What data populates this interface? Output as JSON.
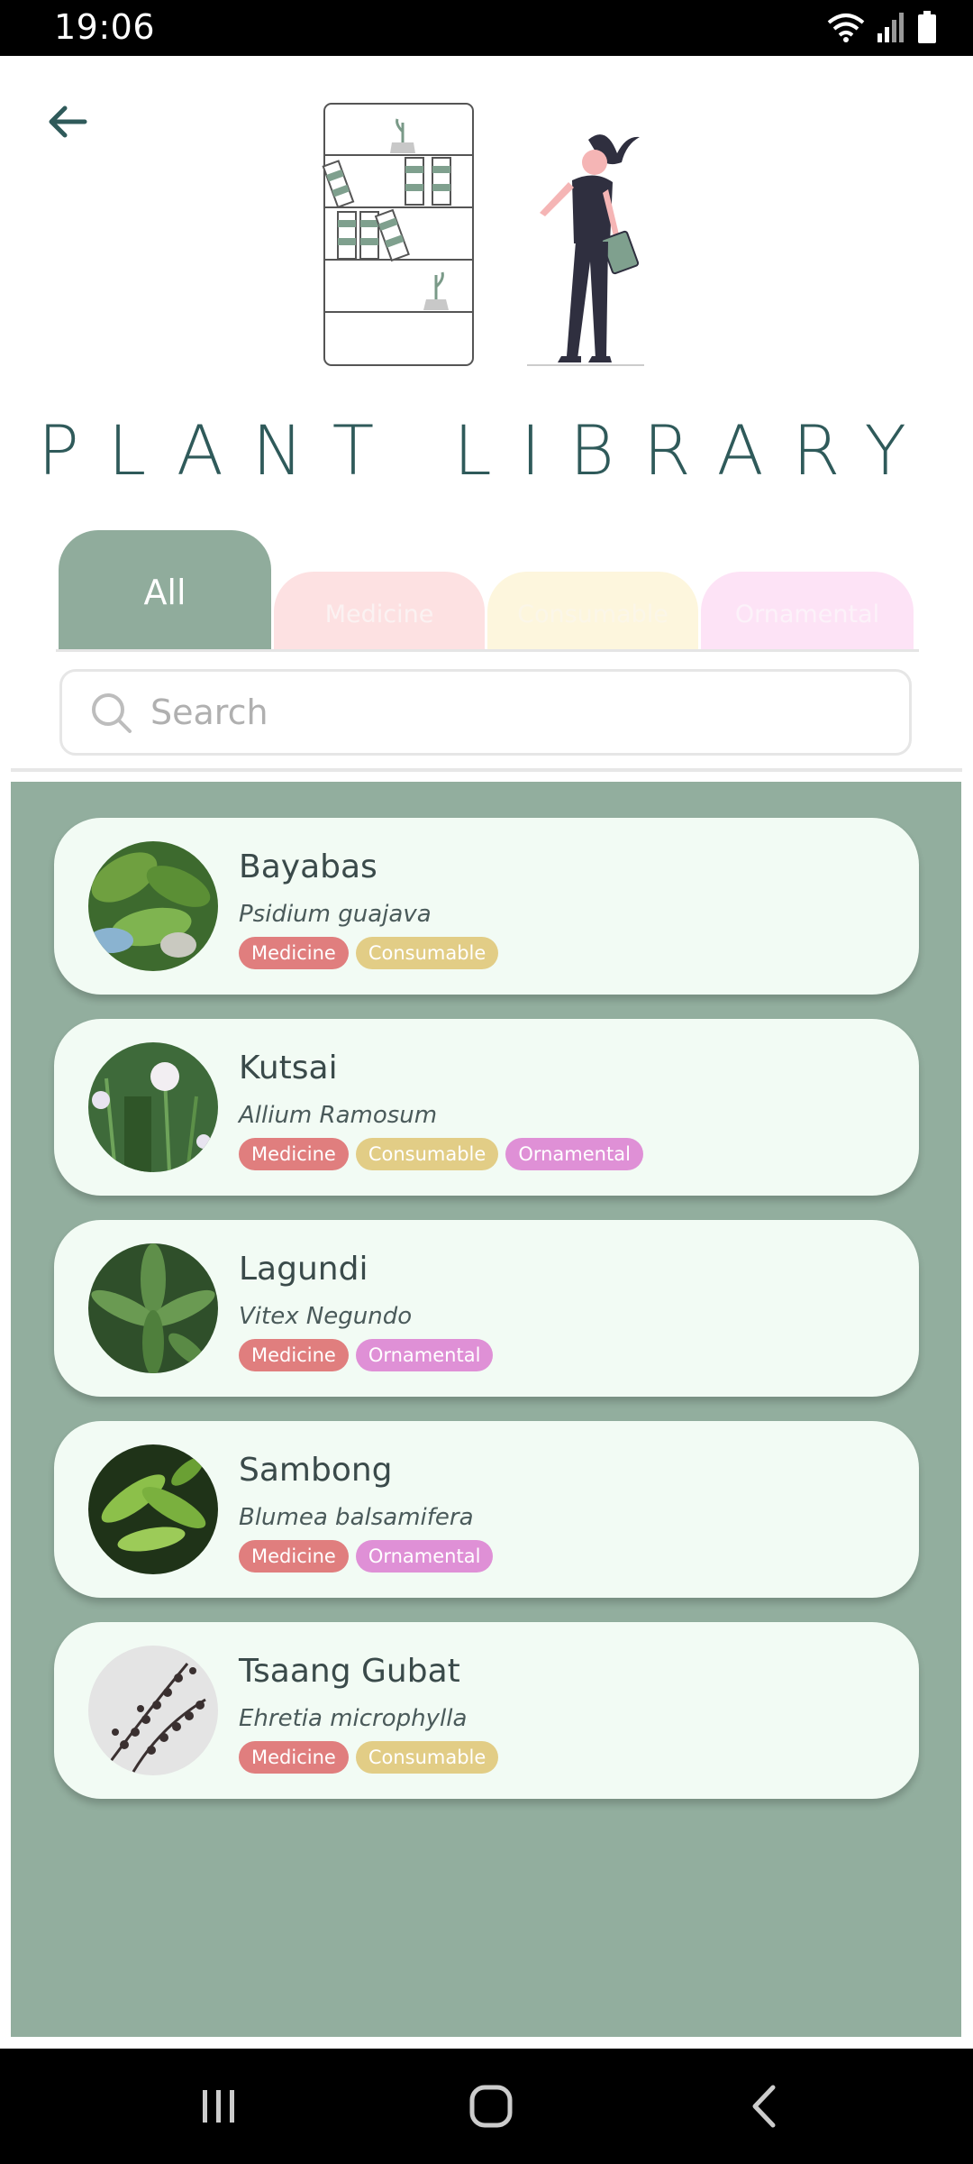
{
  "status_bar": {
    "time": "19:06"
  },
  "header": {
    "title": "PLANT LIBRARY"
  },
  "tabs": [
    {
      "label": "All",
      "active": true
    },
    {
      "label": "Medicine",
      "active": false
    },
    {
      "label": "Consumable",
      "active": false
    },
    {
      "label": "Ornamental",
      "active": false
    }
  ],
  "search": {
    "placeholder": "Search",
    "value": ""
  },
  "plants": [
    {
      "name": "Bayabas",
      "scientific": "Psidium guajava",
      "tags": [
        "Medicine",
        "Consumable"
      ]
    },
    {
      "name": "Kutsai",
      "scientific": "Allium Ramosum",
      "tags": [
        "Medicine",
        "Consumable",
        "Ornamental"
      ]
    },
    {
      "name": "Lagundi",
      "scientific": "Vitex Negundo",
      "tags": [
        "Medicine",
        "Ornamental"
      ]
    },
    {
      "name": "Sambong",
      "scientific": "Blumea balsamifera",
      "tags": [
        "Medicine",
        "Ornamental"
      ]
    },
    {
      "name": "Tsaang Gubat",
      "scientific": "Ehretia microphylla",
      "tags": [
        "Medicine",
        "Consumable"
      ]
    }
  ],
  "colors": {
    "primary": "#2f5a5a",
    "panel": "#92ae9e",
    "tag_medicine": "#e07e7e",
    "tag_consumable": "#e2cd86",
    "tag_ornamental": "#df90d6"
  },
  "icons": [
    "back-arrow-icon",
    "search-icon",
    "wifi-icon",
    "signal-icon",
    "battery-icon",
    "recent-apps-icon",
    "home-icon",
    "back-icon"
  ]
}
